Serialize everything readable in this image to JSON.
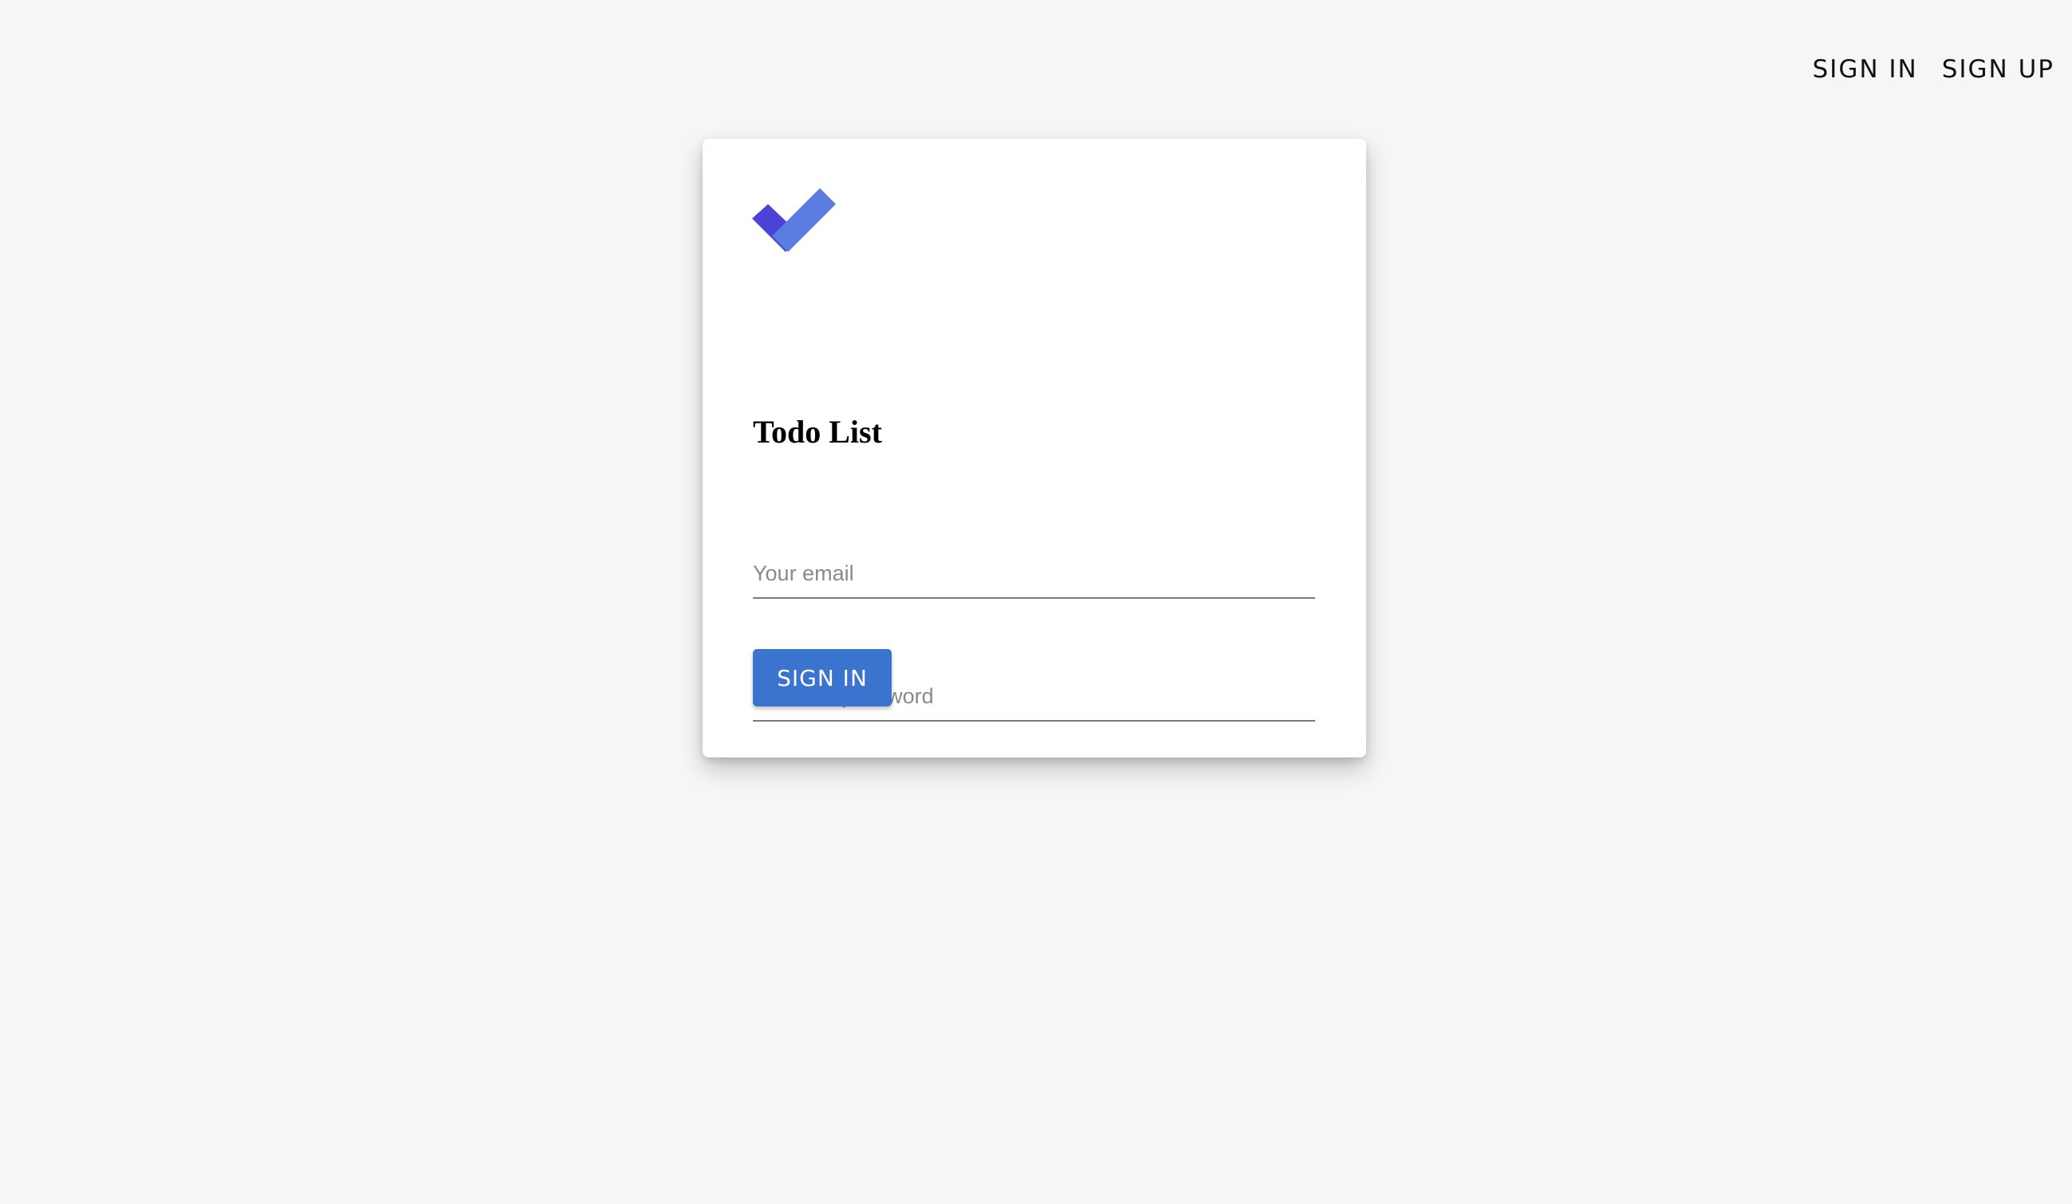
{
  "topnav": {
    "signin_label": "SIGN IN",
    "signup_label": "SIGN UP"
  },
  "card": {
    "logo_icon": "double-check-icon",
    "title": "Todo List",
    "email_placeholder": "Your email",
    "email_value": "",
    "password_placeholder": "Create a password",
    "password_value": "",
    "submit_label": "SIGN IN"
  },
  "colors": {
    "background": "#f5f6f8",
    "card": "#ffffff",
    "primary_button": "#3b74cf",
    "logo_dark": "#4b42d8",
    "logo_light": "#5a7be0"
  }
}
